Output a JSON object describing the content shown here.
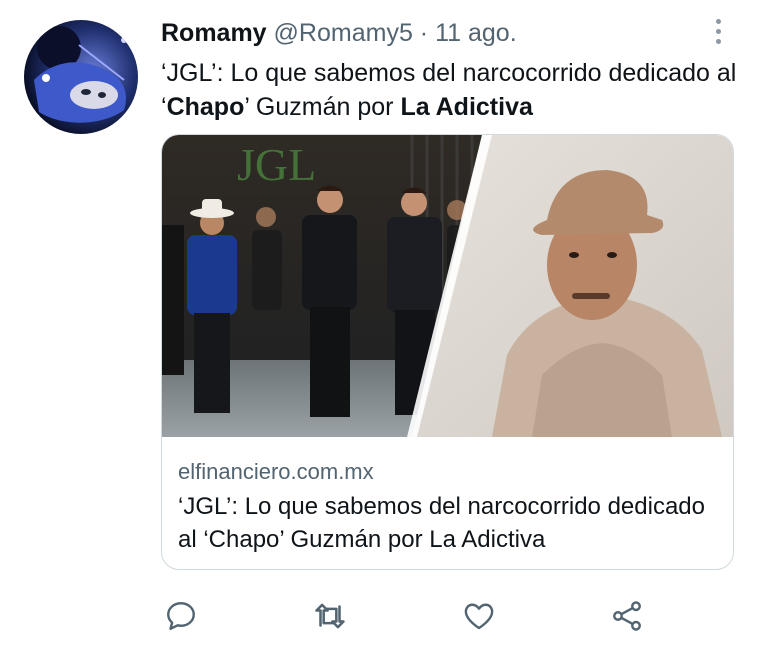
{
  "tweet": {
    "author_name": "Romamy",
    "author_handle": "@Romamy5",
    "separator": "·",
    "date": "11 ago.",
    "text_parts": {
      "p1": "‘JGL’: Lo que sabemos del narcocorrido dedicado al ‘",
      "p2": "Chapo",
      "p3": "’ Guzmán por ",
      "p4": "La Adictiva"
    }
  },
  "card": {
    "image_overlay_text": "JGL",
    "domain": "elfinanciero.com.mx",
    "title": "‘JGL’: Lo que sabemos del narcocorrido dedicado al ‘Chapo’ Guzmán por La Adictiva"
  },
  "actions": [
    {
      "icon": "reply-icon"
    },
    {
      "icon": "retweet-icon"
    },
    {
      "icon": "like-icon"
    },
    {
      "icon": "share-icon"
    }
  ],
  "colors": {
    "text_primary": "#0f1419",
    "text_secondary": "#536471",
    "border": "#cfd9de"
  }
}
